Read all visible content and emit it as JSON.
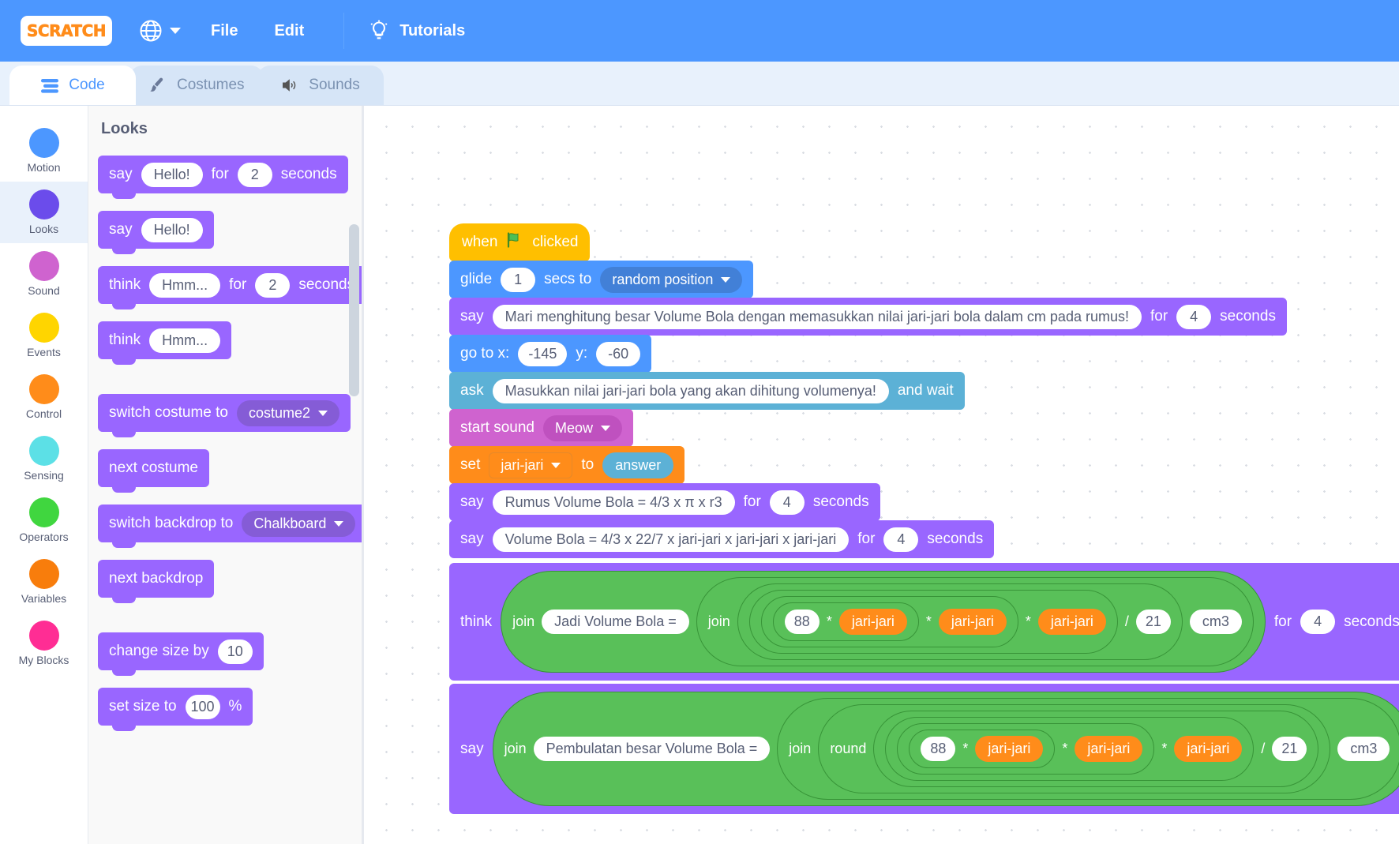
{
  "menubar": {
    "logo_text": "SCRATCH",
    "globe_icon": "globe-icon",
    "items": [
      {
        "label": "File"
      },
      {
        "label": "Edit"
      }
    ],
    "tutorials_label": "Tutorials",
    "bulb_icon": "lightbulb-icon",
    "bg_color": "#4c97ff"
  },
  "tabs": [
    {
      "label": "Code",
      "icon": "code-icon",
      "active": true
    },
    {
      "label": "Costumes",
      "icon": "paintbrush-icon",
      "active": false
    },
    {
      "label": "Sounds",
      "icon": "speaker-icon",
      "active": false
    }
  ],
  "categories": [
    {
      "label": "Motion",
      "color": "#4c97ff",
      "selected": false
    },
    {
      "label": "Looks",
      "color": "#6b4ceb",
      "selected": true
    },
    {
      "label": "Sound",
      "color": "#cf63cf",
      "selected": false
    },
    {
      "label": "Events",
      "color": "#ffd500",
      "selected": false
    },
    {
      "label": "Control",
      "color": "#ff8c1a",
      "selected": false
    },
    {
      "label": "Sensing",
      "color": "#5ce0e6",
      "selected": false
    },
    {
      "label": "Operators",
      "color": "#40d63f",
      "selected": false
    },
    {
      "label": "Variables",
      "color": "#f87d0c",
      "selected": false
    },
    {
      "label": "My Blocks",
      "color": "#ff2d94",
      "selected": false
    }
  ],
  "palette": {
    "title": "Looks",
    "blocks": [
      {
        "k": "say_for",
        "w1": "say",
        "text": "Hello!",
        "w2": "for",
        "num": "2",
        "w3": "seconds"
      },
      {
        "k": "say",
        "w1": "say",
        "text": "Hello!"
      },
      {
        "k": "think_for",
        "w1": "think",
        "text": "Hmm...",
        "w2": "for",
        "num": "2",
        "w3": "seconds"
      },
      {
        "k": "think",
        "w1": "think",
        "text": "Hmm..."
      },
      {
        "k": "switch_costume",
        "w1": "switch costume to",
        "dropdown": "costume2"
      },
      {
        "k": "next_costume",
        "w1": "next costume"
      },
      {
        "k": "switch_backdrop",
        "w1": "switch backdrop to",
        "dropdown": "Chalkboard"
      },
      {
        "k": "next_backdrop",
        "w1": "next backdrop"
      },
      {
        "k": "change_size",
        "w1": "change size by",
        "num": "10"
      },
      {
        "k": "set_size",
        "w1": "set size to",
        "num": "100",
        "w3": "%"
      }
    ]
  },
  "script": {
    "when_flag": {
      "w1": "when",
      "w2": "clicked",
      "icon": "green-flag-icon"
    },
    "glide": {
      "w1": "glide",
      "num": "1",
      "w2": "secs to",
      "dropdown": "random position"
    },
    "say1": {
      "w1": "say",
      "text": "Mari menghitung besar Volume Bola dengan memasukkan nilai jari-jari bola dalam cm pada rumus!",
      "w2": "for",
      "num": "4",
      "w3": "seconds"
    },
    "goto": {
      "w1": "go to x:",
      "x": "-145",
      "w2": "y:",
      "y": "-60"
    },
    "ask": {
      "w1": "ask",
      "text": "Masukkan nilai jari-jari bola yang akan dihitung volumenya!",
      "w2": "and wait"
    },
    "start_sound": {
      "w1": "start sound",
      "dropdown": "Meow"
    },
    "set_var": {
      "w1": "set",
      "variable": "jari-jari",
      "w2": "to",
      "reporter": "answer"
    },
    "say2": {
      "w1": "say",
      "text": "Rumus Volume Bola = 4/3 x π x r3",
      "w2": "for",
      "num": "4",
      "w3": "seconds"
    },
    "say3": {
      "w1": "say",
      "text": "Volume Bola = 4/3 x 22/7 x jari-jari x jari-jari x jari-jari",
      "w2": "for",
      "num": "4",
      "w3": "seconds"
    },
    "think1": {
      "w1": "think",
      "join": "join",
      "text": "Jadi Volume Bola =",
      "join2": "join",
      "num": "88",
      "mul": "*",
      "v1": "jari-jari",
      "v2": "jari-jari",
      "v3": "jari-jari",
      "div": "/",
      "denom": "21",
      "unit": "cm3",
      "w2": "for",
      "secs": "4",
      "w3": "seconds"
    },
    "say4": {
      "w1": "say",
      "join": "join",
      "text": "Pembulatan besar Volume Bola =",
      "join2": "join",
      "round": "round",
      "num": "88",
      "mul": "*",
      "v1": "jari-jari",
      "v2": "jari-jari",
      "v3": "jari-jari",
      "div": "/",
      "denom": "21",
      "unit": "cm3"
    }
  }
}
